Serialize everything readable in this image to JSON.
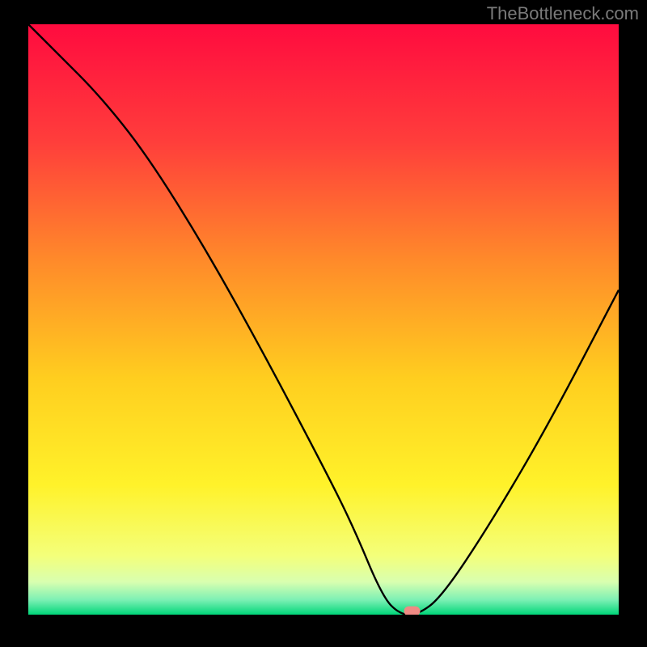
{
  "watermark": "TheBottleneck.com",
  "chart_data": {
    "type": "line",
    "title": "",
    "xlabel": "",
    "ylabel": "",
    "xlim": [
      0,
      100
    ],
    "ylim": [
      0,
      100
    ],
    "series": [
      {
        "name": "curve",
        "x": [
          0,
          5,
          12,
          20,
          30,
          40,
          50,
          55,
          60,
          63,
          66,
          70,
          78,
          88,
          100
        ],
        "values": [
          100,
          95,
          88,
          78,
          62,
          44,
          25,
          15,
          3,
          0,
          0,
          3,
          15,
          32,
          55
        ]
      }
    ],
    "marker": {
      "x": 65,
      "y": 0.6
    },
    "gradient_stops": [
      {
        "t": 0.0,
        "color": "#ff0b3f"
      },
      {
        "t": 0.2,
        "color": "#ff3e3b"
      },
      {
        "t": 0.4,
        "color": "#ff8a2a"
      },
      {
        "t": 0.6,
        "color": "#ffce1f"
      },
      {
        "t": 0.78,
        "color": "#fff22a"
      },
      {
        "t": 0.9,
        "color": "#f4ff7a"
      },
      {
        "t": 0.945,
        "color": "#d8ffb0"
      },
      {
        "t": 0.975,
        "color": "#7cf0b4"
      },
      {
        "t": 1.0,
        "color": "#00d679"
      }
    ]
  }
}
